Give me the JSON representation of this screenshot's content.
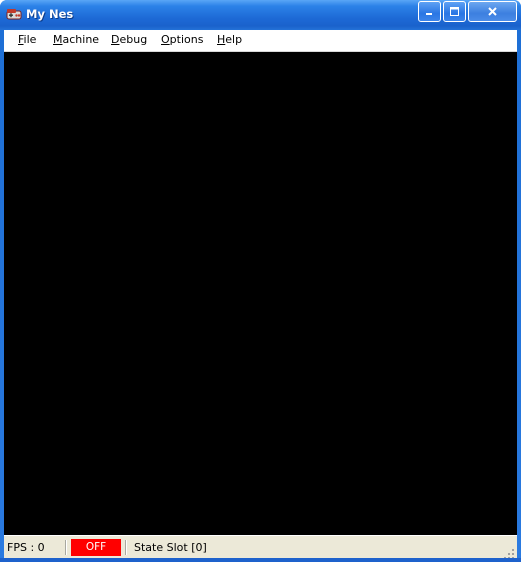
{
  "window": {
    "title": "My Nes",
    "icon": "nes-controller-icon",
    "controls": {
      "minimize_icon": "minimize-icon",
      "maximize_icon": "maximize-icon",
      "close_icon": "close-icon"
    }
  },
  "menubar": {
    "items": [
      {
        "label": "File",
        "accel": "F"
      },
      {
        "label": "Machine",
        "accel": "M"
      },
      {
        "label": "Debug",
        "accel": "D"
      },
      {
        "label": "Options",
        "accel": "O"
      },
      {
        "label": "Help",
        "accel": "H"
      }
    ]
  },
  "screen": {
    "background": "#000000"
  },
  "statusbar": {
    "fps": "FPS : 0",
    "power_status": "OFF",
    "power_color": "#ff0000",
    "state_slot": "State Slot [0]"
  },
  "colors": {
    "titlebar": "#1e6fd6",
    "client": "#ece9d8",
    "menubar": "#ffffff"
  }
}
